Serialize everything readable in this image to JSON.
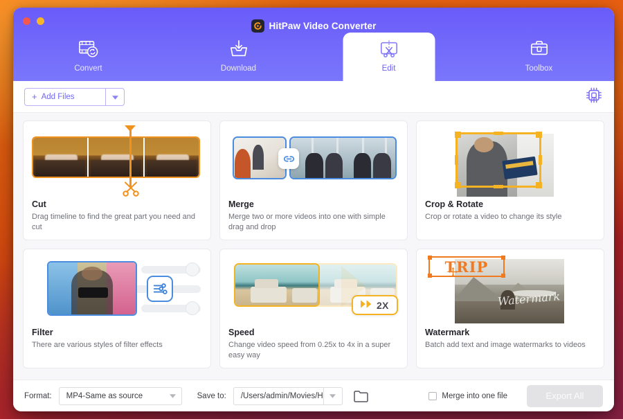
{
  "window": {
    "title": "HitPaw Video Converter",
    "logo_icon": "hitpaw-logo-icon",
    "controls": {
      "close": "close-dot",
      "minimize": "minimize-dot"
    }
  },
  "tabs": [
    {
      "label": "Convert",
      "icon": "convert-icon",
      "active": false
    },
    {
      "label": "Download",
      "icon": "download-icon",
      "active": false
    },
    {
      "label": "Edit",
      "icon": "edit-scissors-icon",
      "active": true
    },
    {
      "label": "Toolbox",
      "icon": "toolbox-icon",
      "active": false
    }
  ],
  "toolbar": {
    "add_files_label": "Add Files",
    "add_files_plus": "+",
    "add_files_caret_icon": "chevron-down-icon",
    "gpu_icon": "hardware-acceleration-icon",
    "gpu_state": "on"
  },
  "cards": [
    {
      "title": "Cut",
      "desc": "Drag timeline to find the great part you need and cut",
      "accent": "#f2921e",
      "art_icon": "scissors-icon"
    },
    {
      "title": "Merge",
      "desc": "Merge two or more videos into one with simple drag and drop",
      "accent": "#4a8ce0",
      "art_icon": "link-chain-icon"
    },
    {
      "title": "Crop & Rotate",
      "desc": "Crop or rotate a video to change its style",
      "accent": "#f5b324",
      "art_icon": "crop-frame-icon"
    },
    {
      "title": "Filter",
      "desc": "There are various styles of filter effects",
      "accent": "#4a8ce0",
      "art_icon": "sliders-icon"
    },
    {
      "title": "Speed",
      "desc": "Change video speed from 0.25x to 4x in a super easy way",
      "accent": "#f5b324",
      "art_icon": "fast-forward-icon",
      "badge": "2X"
    },
    {
      "title": "Watermark",
      "desc": "Batch add text and image watermarks to videos",
      "accent": "#f07a20",
      "art_icon": "move-handle-icon",
      "overlay_text": "TRIP",
      "signature_text": "Watermark"
    }
  ],
  "footer": {
    "format_label": "Format:",
    "format_value": "MP4-Same as source",
    "format_caret_icon": "chevron-down-icon",
    "save_to_label": "Save to:",
    "save_to_value": "/Users/admin/Movies/Hi…",
    "save_to_caret_icon": "chevron-down-icon",
    "folder_icon": "folder-icon",
    "merge_checkbox_label": "Merge into one file",
    "merge_checked": false,
    "export_label": "Export All",
    "export_enabled": false
  }
}
